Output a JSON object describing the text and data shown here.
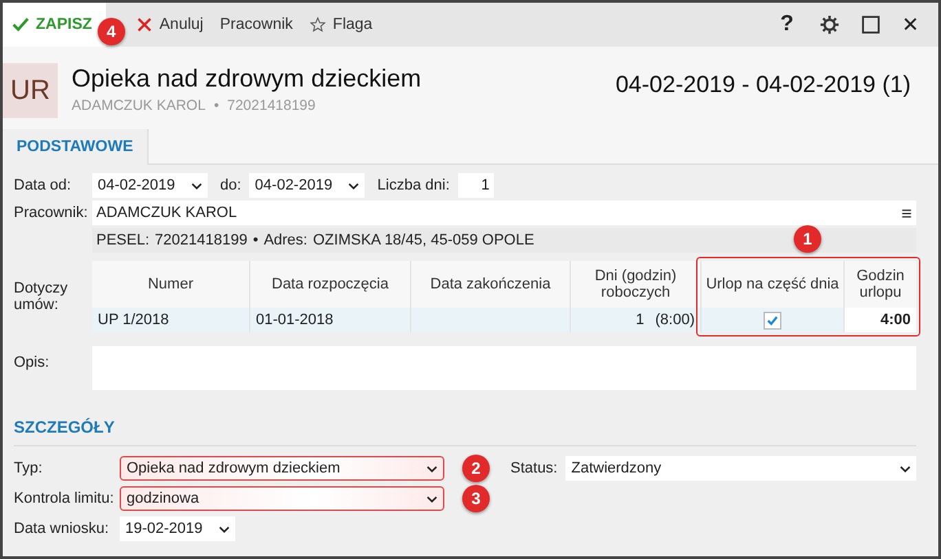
{
  "toolbar": {
    "buttons": [
      {
        "kind": "save",
        "label": "ZAPISZ",
        "callout": "4"
      },
      {
        "kind": "cancel",
        "label": "Anuluj"
      },
      {
        "kind": "plain",
        "label": "Pracownik"
      },
      {
        "kind": "flag",
        "label": "Flaga"
      }
    ],
    "help": "?",
    "close": "✕"
  },
  "header": {
    "badge": "UR",
    "title": "Opieka nad zdrowym dzieckiem",
    "employee": "ADAMCZUK KAROL",
    "separator": "•",
    "id": "72021418199",
    "date_range": "04-02-2019 - 04-02-2019 (1)"
  },
  "tabs": [
    {
      "label": "PODSTAWOWE",
      "selected": true
    }
  ],
  "basic": {
    "date_from_label": "Data od:",
    "date_from": "04-02-2019",
    "date_to_label": "do:",
    "date_to": "04-02-2019",
    "days_label": "Liczba dni:",
    "days": "1",
    "employee_label": "Pracownik:",
    "employee": "ADAMCZUK KAROL",
    "pesel_label": "PESEL:",
    "pesel": "72021418199",
    "separator": "•",
    "address_label": "Adres:",
    "address": "OZIMSKA 18/45, 45-059 OPOLE",
    "contracts_label": "Dotyczy umów:",
    "table": {
      "columns": [
        "Numer",
        "Data rozpoczęcia",
        "Data zakończenia",
        "Dni (godzin) roboczych",
        "Urlop na część dnia",
        "Godzin urlopu"
      ],
      "highlight_callout": "1",
      "rows": [
        {
          "number": "UP 1/2018",
          "start": "01-01-2018",
          "days": "1",
          "hours_worked": "(8:00)",
          "partial_day": true,
          "leave_hours": "4:00"
        }
      ]
    },
    "description_label": "Opis:"
  },
  "details": {
    "title": "SZCZEGÓŁY",
    "type_label": "Typ:",
    "type": "Opieka nad zdrowym dzieckiem",
    "type_callout": "2",
    "status_label": "Status:",
    "status": "Zatwierdzony",
    "limit_label": "Kontrola limitu:",
    "limit": "godzinowa",
    "limit_callout": "3",
    "request_date_label": "Data wniosku:",
    "request_date": "19-02-2019"
  }
}
